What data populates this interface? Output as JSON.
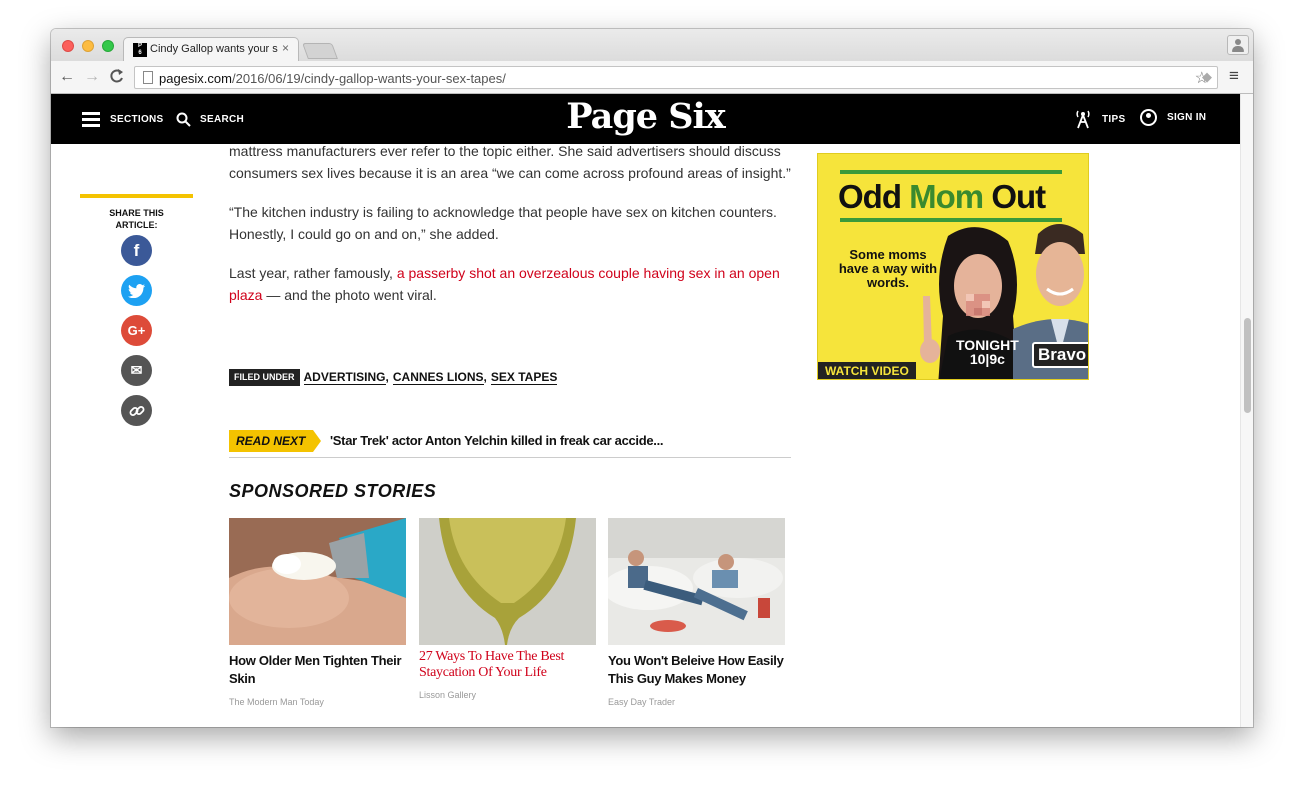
{
  "browser": {
    "tab_title": "Cindy Gallop wants your se",
    "tab_favicon_text": "Page Six",
    "tab_close": "×",
    "url_host": "pagesix.com",
    "url_path": "/2016/06/19/cindy-gallop-wants-your-sex-tapes/",
    "back_icon": "←",
    "forward_icon": "→",
    "reload_icon": "C",
    "star_icon": "☆",
    "menu_icon": "≡"
  },
  "header": {
    "sections_label": "SECTIONS",
    "search_label": "SEARCH",
    "logo": "Page Six",
    "tips_label": "TIPS",
    "signin_label": "SIGN IN"
  },
  "share": {
    "label": "SHARE THIS ARTICLE:",
    "buttons": [
      {
        "name": "facebook-icon",
        "glyph": "f"
      },
      {
        "name": "twitter-icon",
        "glyph": "t"
      },
      {
        "name": "google-plus-icon",
        "glyph": "G+"
      },
      {
        "name": "email-icon",
        "glyph": "✉"
      },
      {
        "name": "link-icon",
        "glyph": "⊶"
      }
    ]
  },
  "article": {
    "p1": "mattress manufacturers ever refer to the topic either. She said advertisers should discuss consumers sex lives because it is an area “we can come across profound areas of insight.”",
    "p2": "“The kitchen industry is failing to acknowledge that people have sex on kitchen counters. Honestly, I could go on and on,” she added.",
    "p3_prefix": "Last year, rather famously, ",
    "p3_link": "a passerby shot an overzealous couple having sex in an open plaza",
    "p3_suffix": " — and the photo went viral.",
    "filed_under_label": "FILED UNDER",
    "tags": [
      "ADVERTISING",
      "CANNES LIONS",
      "SEX TAPES"
    ],
    "read_next_label": "READ NEXT",
    "read_next_title": "'Star Trek' actor Anton Yelchin killed in freak car accide..."
  },
  "sponsored": {
    "heading": "SPONSORED STORIES",
    "stories": [
      {
        "title": "How Older Men Tighten Their Skin",
        "source": "The Modern Man Today"
      },
      {
        "title": "27 Ways To Have The Best Staycation Of Your Life",
        "source": "Lisson Gallery"
      },
      {
        "title": "You Won't Beleive How Easily This Guy Makes Money",
        "source": "Easy Day Trader"
      }
    ]
  },
  "ad": {
    "title_odd": "Odd ",
    "title_mom": "Mom",
    "title_out": " Out",
    "tagline": "Some moms have a way with words.",
    "tonight": "TONIGHT",
    "time": "10|9c",
    "network": "Bravo",
    "cta": "WATCH VIDEO"
  },
  "colors": {
    "accent_yellow": "#f4c300",
    "link_red": "#d0021b",
    "header_black": "#000000"
  }
}
